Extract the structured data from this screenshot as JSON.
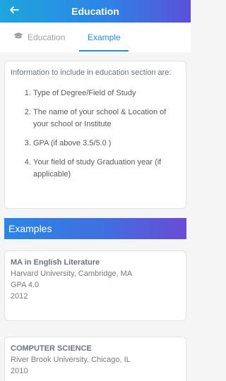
{
  "header": {
    "title": "Education",
    "back_icon": "arrow-left-icon"
  },
  "tabs": [
    {
      "label": "Education",
      "icon": "graduation-cap-icon"
    },
    {
      "label": "Example"
    }
  ],
  "active_tab": "Example",
  "info": {
    "intro": "Information to include in education section are:",
    "items": [
      "Type of Degree/Field of Study",
      "The name of your school & Location of your school or Institute",
      "GPA (if above 3.5/5.0 )",
      "Your field of study Graduation year (if applicable)"
    ]
  },
  "examples": {
    "heading": "Examples",
    "cards": [
      {
        "degree": "MA in English Literature",
        "school": "Harvard University, Cambridge, MA",
        "gpa": "GPA 4.0",
        "year": "2012"
      },
      {
        "degree": "COMPUTER SCIENCE",
        "school": "River Brook University, Chicago, IL",
        "year": "2010"
      }
    ]
  },
  "colors": {
    "header_gradient": [
      "#1ea6dd",
      "#2d84e6",
      "#5b50d9"
    ],
    "accent": "#1e90e5"
  }
}
